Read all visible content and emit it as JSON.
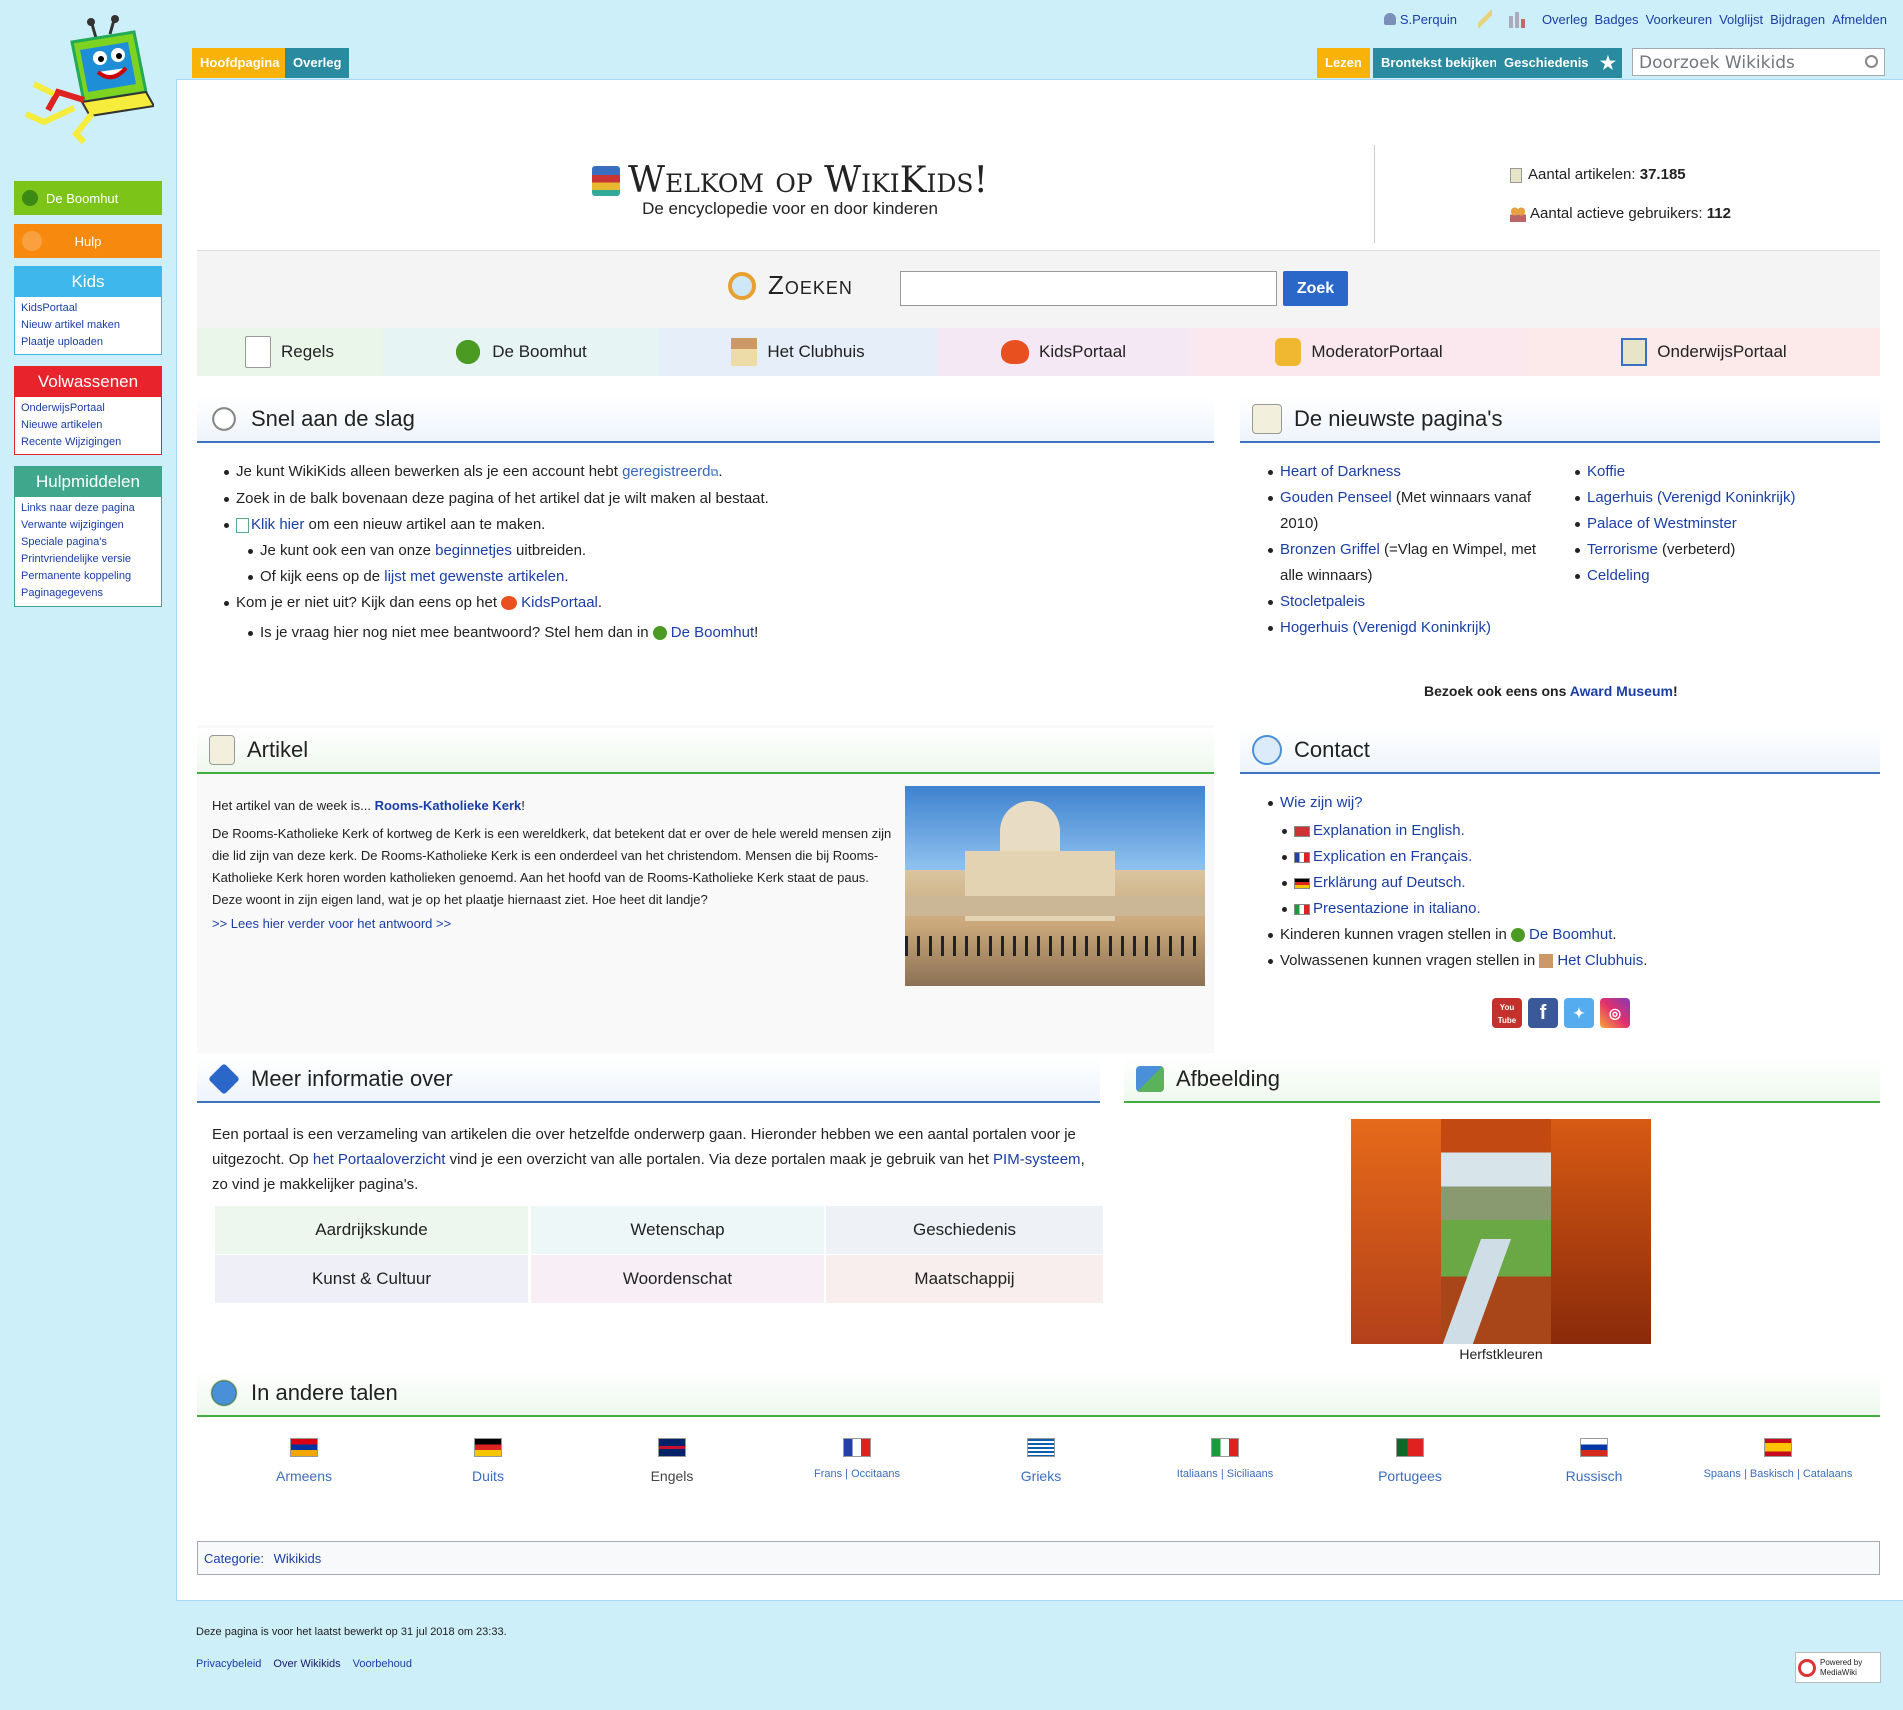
{
  "personal": {
    "user": "S.Perquin",
    "links": [
      "Overleg",
      "Badges",
      "Voorkeuren",
      "Volglijst",
      "Bijdragen",
      "Afmelden"
    ]
  },
  "tabs": {
    "left": [
      "Hoofdpagina",
      "Overleg"
    ],
    "right": [
      "Lezen",
      "Brontekst bekijken",
      "Geschiedenis"
    ]
  },
  "search": {
    "placeholder": "Doorzoek Wikikids"
  },
  "sidebar": {
    "btn1": "De Boomhut",
    "btn2": "Hulp",
    "kids": {
      "title": "Kids",
      "items": [
        "KidsPortaal",
        "Nieuw artikel maken",
        "Plaatje uploaden"
      ]
    },
    "adults": {
      "title": "Volwassenen",
      "items": [
        "OnderwijsPortaal",
        "Nieuwe artikelen",
        "Recente Wijzigingen"
      ]
    },
    "tools": {
      "title": "Hulpmiddelen",
      "items": [
        "Links naar deze pagina",
        "Verwante wijzigingen",
        "Speciale pagina's",
        "Printvriendelijke versie",
        "Permanente koppeling",
        "Paginagegevens"
      ]
    }
  },
  "header": {
    "title": "Welkom op WikiKids!",
    "subtitle": "De encyclopedie voor en door kinderen",
    "stat1_label": "Aantal artikelen:",
    "stat1_value": "37.185",
    "stat2_label": "Aantal actieve gebruikers:",
    "stat2_value": "112"
  },
  "zoeken": {
    "title": "Zoeken",
    "button": "Zoek"
  },
  "portals": [
    "Regels",
    "De Boomhut",
    "Het Clubhuis",
    "KidsPortaal",
    "ModeratorPortaal",
    "OnderwijsPortaal"
  ],
  "snel": {
    "title": "Snel aan de slag",
    "l1a": "Je kunt WikiKids alleen bewerken als je een account hebt ",
    "l1link": "geregistreerd",
    "l1b": ".",
    "l2": "Zoek in de balk bovenaan deze pagina of het artikel dat je wilt maken al bestaat.",
    "l3link": "Klik hier",
    "l3b": " om een nieuw artikel aan te maken.",
    "l4a": "Je kunt ook een van onze ",
    "l4link": "beginnetjes",
    "l4b": " uitbreiden.",
    "l5a": "Of kijk eens op de ",
    "l5link": "lijst met gewenste artikelen",
    "l5b": ".",
    "l6a": "Kom je er niet uit? Kijk dan eens op het ",
    "l6link": "KidsPortaal",
    "l6b": ".",
    "l7a": "Is je vraag hier nog niet mee beantwoord? Stel hem dan in ",
    "l7link": "De Boomhut",
    "l7b": "!"
  },
  "nieuwste": {
    "title": "De nieuwste pagina's",
    "col1": [
      {
        "link": "Heart of Darkness",
        "rest": ""
      },
      {
        "link": "Gouden Penseel",
        "rest": " (Met winnaars vanaf 2010)"
      },
      {
        "link": "Bronzen Griffel",
        "rest": " (=Vlag en Wimpel, met alle winnaars)"
      },
      {
        "link": "Stocletpaleis",
        "rest": ""
      },
      {
        "link": "Hogerhuis (Verenigd Koninkrijk)",
        "rest": ""
      }
    ],
    "col2": [
      {
        "link": "Koffie",
        "rest": ""
      },
      {
        "link": "Lagerhuis (Verenigd Koninkrijk)",
        "rest": ""
      },
      {
        "link": "Palace of Westminster",
        "rest": ""
      },
      {
        "link": "Terrorisme",
        "rest": " (verbeterd)"
      },
      {
        "link": "Celdeling",
        "rest": ""
      }
    ],
    "award_a": "Bezoek ook eens ons ",
    "award_link": "Award Museum",
    "award_b": "!"
  },
  "artikel": {
    "title": "Artikel",
    "intro": "Het artikel van de week is... ",
    "intro_link": "Rooms-Katholieke Kerk",
    "intro_end": "!",
    "body": "De Rooms-Katholieke Kerk of kortweg de Kerk is een wereldkerk, dat betekent dat er over de hele wereld mensen zijn die lid zijn van deze kerk. De Rooms-Katholieke Kerk is een onderdeel van het christendom. Mensen die bij Rooms-Katholieke Kerk horen worden katholieken genoemd. Aan het hoofd van de Rooms-Katholieke Kerk staat de paus. Deze woont in zijn eigen land, wat je op het plaatje hiernaast ziet. Hoe heet dit landje?",
    "more": ">> Lees hier verder voor het antwoord >>"
  },
  "contact": {
    "title": "Contact",
    "who": "Wie zijn wij?",
    "langs": [
      "Explanation in English.",
      "Explication en Français.",
      "Erklärung auf Deutsch.",
      "Presentazione in italiano."
    ],
    "kids_a": "Kinderen kunnen vragen stellen in ",
    "kids_link": "De Boomhut",
    "kids_b": ".",
    "adults_a": "Volwassenen kunnen vragen stellen in ",
    "adults_link": "Het Clubhuis",
    "adults_b": ".",
    "youtube": "You Tube"
  },
  "meer": {
    "title": "Meer informatie over",
    "p1": "Een portaal is een verzameling van artikelen die over hetzelfde onderwerp gaan. Hieronder hebben we een aantal portalen voor je uitgezocht. Op ",
    "p_link1": "het Portaaloverzicht",
    "p2": " vind je een overzicht van alle portalen. Via deze portalen maak je gebruik van het ",
    "p_link2": "PIM-systeem",
    "p3": ", zo vind je makkelijker pagina's.",
    "cells": [
      "Aardrijkskunde",
      "Wetenschap",
      "Geschiedenis",
      "Kunst & Cultuur",
      "Woordenschat",
      "Maatschappij"
    ]
  },
  "afbeelding": {
    "title": "Afbeelding",
    "caption": "Herfstkleuren"
  },
  "talen": {
    "title": "In andere talen",
    "items": [
      {
        "label": "Armeens"
      },
      {
        "label": "Duits"
      },
      {
        "label": "Engels"
      },
      {
        "label": "Frans | Occitaans"
      },
      {
        "label": "Grieks"
      },
      {
        "label": "Italiaans | Siciliaans"
      },
      {
        "label": "Portugees"
      },
      {
        "label": "Russisch"
      },
      {
        "label": "Spaans | Baskisch | Catalaans"
      }
    ]
  },
  "categorie": {
    "label": "Categorie:",
    "value": "Wikikids"
  },
  "footer": {
    "edited": "Deze pagina is voor het laatst bewerkt op 31 jul 2018 om 23:33.",
    "links": [
      "Privacybeleid",
      "Over Wikikids",
      "Voorbehoud"
    ],
    "powered": "Powered by MediaWiki"
  }
}
